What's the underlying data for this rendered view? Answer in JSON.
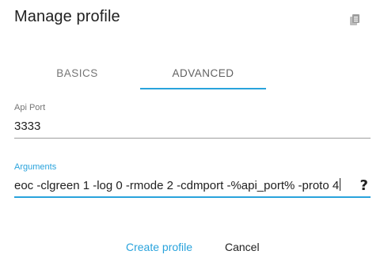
{
  "dialog": {
    "title": "Manage profile"
  },
  "toolbar": {
    "copy_icon": "copy-icon"
  },
  "tabs": [
    {
      "label": "BASICS",
      "active": false
    },
    {
      "label": "ADVANCED",
      "active": true
    }
  ],
  "fields": {
    "api_port": {
      "label": "Api Port",
      "value": "3333"
    },
    "arguments": {
      "label": "Arguments",
      "value": "eoc -clgreen 1 -log 0 -rmode 2 -cdmport -%api_port% -proto 4",
      "help_glyph": "?"
    }
  },
  "actions": {
    "create_label": "Create profile",
    "cancel_label": "Cancel"
  },
  "colors": {
    "accent": "#29a3dc",
    "text": "#212121",
    "muted": "#757575"
  }
}
